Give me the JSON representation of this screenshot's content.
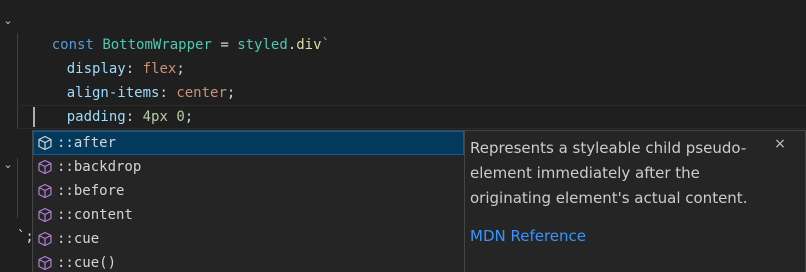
{
  "code": {
    "line1": {
      "kw": "const",
      "name": "BottomWrapper",
      "eq": "=",
      "obj": "styled",
      "dot": ".",
      "fn": "div",
      "tick": "`"
    },
    "decls": [
      {
        "prop": "display",
        "colon": ":",
        "value": "flex",
        "semi": ";"
      },
      {
        "prop": "align-items",
        "colon": ":",
        "value": "center",
        "semi": ";"
      },
      {
        "prop": "padding",
        "colon": ":",
        "value": "4px 0",
        "semi": ";"
      }
    ],
    "trailing_chars": "`;"
  },
  "suggest": {
    "items": [
      {
        "label": "::after",
        "selected": true
      },
      {
        "label": "::backdrop",
        "selected": false
      },
      {
        "label": "::before",
        "selected": false
      },
      {
        "label": "::content",
        "selected": false
      },
      {
        "label": "::cue",
        "selected": false
      },
      {
        "label": "::cue()",
        "selected": false
      }
    ],
    "icon": "symbol-property-cube-icon"
  },
  "details": {
    "description": "Represents a styleable child pseudo-element immediately after the originating element's actual content.",
    "reference_link": "MDN Reference",
    "close_icon": "close-icon"
  },
  "colors": {
    "background": "#1f1f1f",
    "keyword": "#569cd6",
    "type": "#4ec9b0",
    "function": "#dcdcaa",
    "property": "#9cdcfe",
    "string_value": "#ce9178",
    "number": "#b5cea8",
    "selection": "#04395e",
    "link": "#3794ff"
  }
}
